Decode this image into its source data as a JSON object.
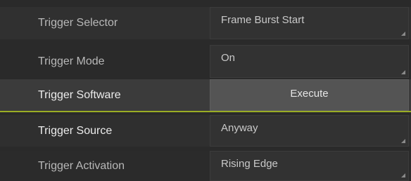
{
  "colors": {
    "accent_divider": "#9aad24",
    "panel_bg": "#2a2a2a",
    "field_bg": "#323232",
    "button_bg": "#545454"
  },
  "properties": [
    {
      "label": "Trigger Selector",
      "value": "Frame Burst Start",
      "control": "dropdown"
    },
    {
      "label": "Trigger Mode",
      "value": "On",
      "control": "dropdown"
    },
    {
      "label": "Trigger Software",
      "value": "Execute",
      "control": "button"
    },
    {
      "label": "Trigger Source",
      "value": "Anyway",
      "control": "dropdown"
    },
    {
      "label": "Trigger Activation",
      "value": "Rising Edge",
      "control": "dropdown"
    }
  ]
}
